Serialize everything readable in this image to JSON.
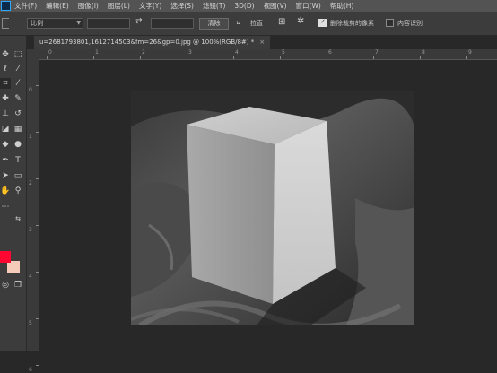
{
  "menu": {
    "items": [
      "文件(F)",
      "编辑(E)",
      "图像(I)",
      "图层(L)",
      "文字(Y)",
      "选择(S)",
      "滤镜(T)",
      "3D(D)",
      "视图(V)",
      "窗口(W)",
      "帮助(H)"
    ]
  },
  "options": {
    "ratio_label": "比例",
    "clear_label": "清除",
    "straighten_label": "拉直",
    "delete_cropped_label": "删除裁剪的像素",
    "delete_cropped_checked": true,
    "content_aware_label": "内容识别",
    "content_aware_checked": false
  },
  "document": {
    "tab_title": "u=2681793801,1612714503&fm=26&gp=0.jpg @ 100%(RGB/8#) *",
    "close_glyph": "×"
  },
  "rulers": {
    "top_numbers": [
      "0",
      "1",
      "2",
      "3",
      "4",
      "5",
      "6",
      "7",
      "8",
      "9"
    ],
    "left_numbers": [
      "0",
      "1",
      "2",
      "3",
      "4",
      "5",
      "6"
    ]
  },
  "colors": {
    "foreground": "#fe0632",
    "background": "#f5cbb9",
    "ui_dark": "#282828",
    "ui_panel": "#3c3c3c",
    "menubar": "#535353"
  },
  "tools": {
    "icons": [
      "move-icon",
      "marquee-icon",
      "lasso-icon",
      "magic-wand-icon",
      "crop-icon",
      "eyedropper-icon",
      "healing-icon",
      "brush-icon",
      "stamp-icon",
      "history-brush-icon",
      "eraser-icon",
      "gradient-icon",
      "blur-icon",
      "dodge-icon",
      "pen-icon",
      "type-icon",
      "path-select-icon",
      "rectangle-icon",
      "hand-icon",
      "zoom-icon"
    ]
  }
}
